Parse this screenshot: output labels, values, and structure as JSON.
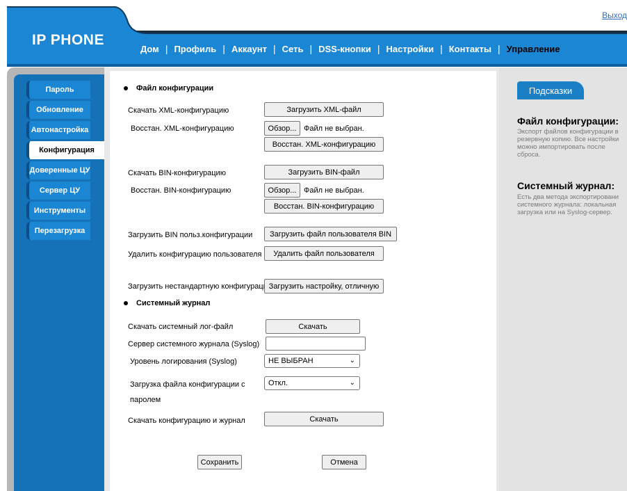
{
  "header": {
    "logout": "Выход",
    "brand": "IP PHONE",
    "nav": [
      "Дом",
      "Профиль",
      "Аккаунт",
      "Сеть",
      "DSS-кнопки",
      "Настройки",
      "Контакты",
      "Управление"
    ],
    "active_nav": "Управление"
  },
  "sidebar": {
    "items": [
      "Пароль",
      "Обновление",
      "Автонастройка",
      "Конфигурация",
      "Доверенные ЦУ",
      "Сервер ЦУ",
      "Инструменты",
      "Перезагрузка"
    ],
    "active": "Конфигурация"
  },
  "config": {
    "section_title": "Файл конфигурации",
    "download_xml_label": "Скачать XML-конфигурацию",
    "download_xml_button": "Загрузить XML-файл",
    "restore_xml_label": "Восстан. XML-конфигурацию",
    "browse_button": "Обзор...",
    "no_file": "Файл не выбран.",
    "restore_xml_button": "Восстан. XML-конфигурацию",
    "download_bin_label": "Скачать BIN-конфигурацию",
    "download_bin_button": "Загрузить BIN-файл",
    "restore_bin_label": "Восстан. BIN-конфигурацию",
    "restore_bin_button": "Восстан. BIN-конфигурацию",
    "upload_user_bin_label": "Загрузить BIN польз.конфигурации",
    "upload_user_bin_button": "Загрузить файл пользователя BIN",
    "delete_user_label": "Удалить конфигурацию пользователя",
    "delete_user_button": "Удалить файл пользователя",
    "upload_custom_label": "Загрузить нестандартную конфигурацию",
    "upload_custom_button": "Загрузить настройку, отличную"
  },
  "syslog": {
    "section_title": "Системный журнал",
    "download_log_label": "Скачать системный лог-файл",
    "download_log_button": "Скачать",
    "server_label": "Сервер системного журнала (Syslog)",
    "server_value": "",
    "level_label": "Уровень логирования (Syslog)",
    "level_value": "НЕ ВЫБРАН",
    "pwd_upload_label_1": "Загрузка файла конфигурации с",
    "pwd_upload_label_2": "паролем",
    "pwd_upload_value": "Откл.",
    "download_all_label": "Скачать конфигурацию и журнал",
    "download_all_button": "Скачать"
  },
  "actions": {
    "save": "Сохранить",
    "cancel": "Отмена"
  },
  "hints": {
    "tab": "Подсказки",
    "title1": "Файл конфигурации:",
    "body1": "Экспорт файлов конфигурации в резервную копию. Все настройки можно импортировать после сброса.",
    "title2": "Системный журнал:",
    "body2": "Есть два метода экспортировани системного журнала: локальная загрузка или на Syslog-сервер."
  },
  "colors": {
    "header_blue": "#1b86d4",
    "header_dark": "#1e2a38",
    "sidebar_blue": "#1672b8",
    "hint_text": "#7a7a7a"
  }
}
